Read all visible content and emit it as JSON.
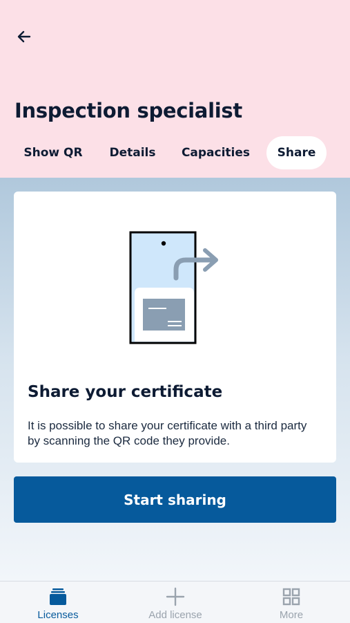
{
  "header": {
    "back_icon": "arrow-left-icon",
    "title": "Inspection specialist"
  },
  "tabs": [
    {
      "label": "Show QR",
      "active": false
    },
    {
      "label": "Details",
      "active": false
    },
    {
      "label": "Capacities",
      "active": false
    },
    {
      "label": "Share",
      "active": true
    }
  ],
  "card": {
    "illustration_icon": "phone-share-icon",
    "title": "Share your certificate",
    "text": "It is possible to share your certificate with a third party by scanning the QR code they provide."
  },
  "primary_button": {
    "label": "Start sharing"
  },
  "bottom_nav": [
    {
      "label": "Licenses",
      "icon": "licenses-stack-icon",
      "active": true
    },
    {
      "label": "Add license",
      "icon": "plus-icon",
      "active": false
    },
    {
      "label": "More",
      "icon": "grid-icon",
      "active": false
    }
  ],
  "colors": {
    "header_bg": "#fce0e7",
    "accent": "#065a9c",
    "text": "#0d1b33"
  }
}
